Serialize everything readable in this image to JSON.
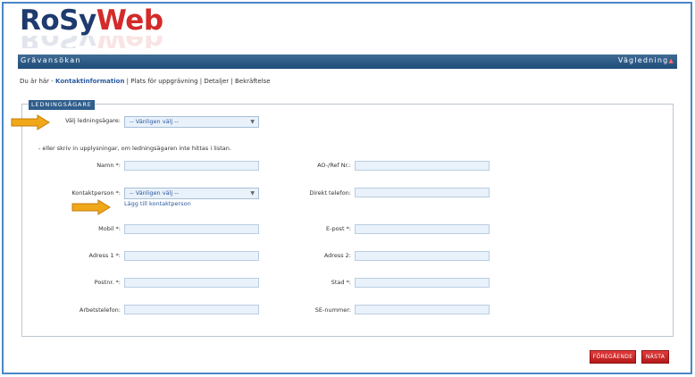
{
  "logo": {
    "part1": "RoSy",
    "part2": "Web"
  },
  "header": {
    "title": "Grävansökan",
    "guide": "Vägledning",
    "guide_mark": "▲"
  },
  "breadcrumb": {
    "prefix": "Du är här - ",
    "steps": [
      "Kontaktinformation",
      "Plats för uppgrävning",
      "Detaljer",
      "Bekräftelse"
    ],
    "separator": " | "
  },
  "section": {
    "legend": "LEDNINGSÄGARE"
  },
  "form": {
    "owner_label": "Välj ledningsägare:",
    "owner_select": "-- Vänligen välj --",
    "note": "- eller skriv in upplysningar, om ledningsägaren inte hittas i listan.",
    "name_label": "Namn *:",
    "org_label": "AO-/Ref Nr.:",
    "contact_label": "Kontaktperson *:",
    "contact_select": "-- Vänligen välj --",
    "add_contact": "Lägg till kontaktperson",
    "direct_phone_label": "Direkt telefon:",
    "mobile_label": "Mobil *:",
    "email_label": "E-post *:",
    "address1_label": "Adress 1 *:",
    "address2_label": "Adress 2:",
    "postnr_label": "Postnr. *:",
    "city_label": "Stad *:",
    "workphone_label": "Arbetstelefon:",
    "se_label": "SE-nummer:"
  },
  "buttons": {
    "previous": "FÖREGÅENDE",
    "next": "NÄSTA"
  },
  "colors": {
    "accent": "#2f5e8c",
    "button": "#c42020",
    "arrow": "#f0a818",
    "field_bg": "#e9f1fa"
  }
}
